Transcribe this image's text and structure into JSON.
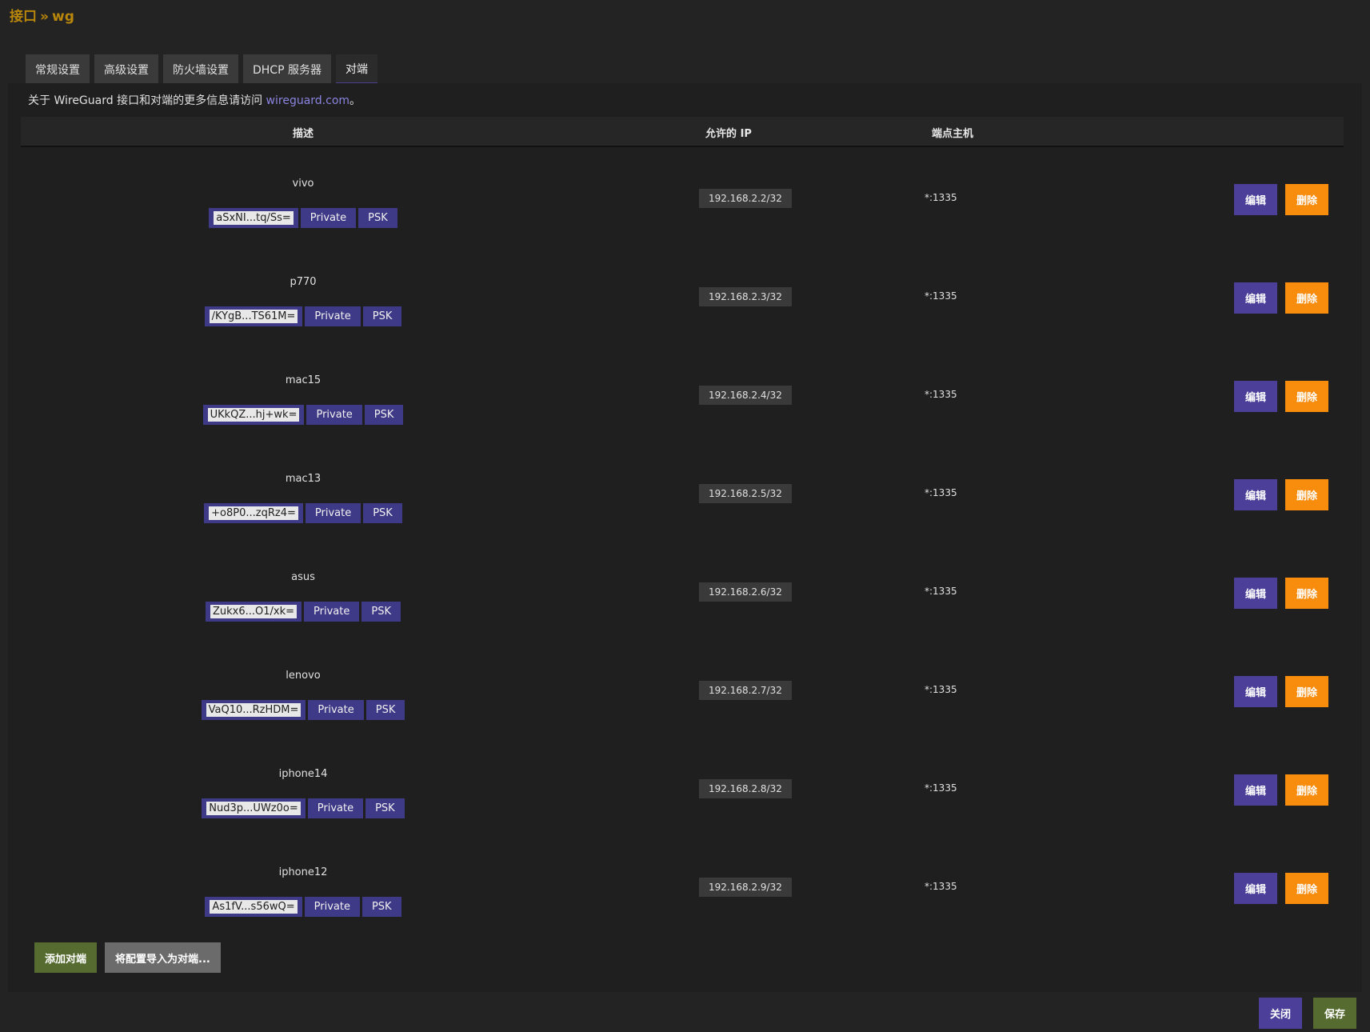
{
  "header": {
    "title_main": "接口",
    "title_sep": "»",
    "title_sub": "wg"
  },
  "tabs": [
    {
      "label": "常规设置"
    },
    {
      "label": "高级设置"
    },
    {
      "label": "防火墙设置"
    },
    {
      "label": "DHCP 服务器"
    },
    {
      "label": "对端"
    }
  ],
  "intro": {
    "text": "关于 WireGuard 接口和对端的更多信息请访问 ",
    "link": "wireguard.com",
    "suffix": "。"
  },
  "table": {
    "headers": {
      "desc": "描述",
      "allowed_ip": "允许的 IP",
      "endpoint": "端点主机"
    },
    "rows": [
      {
        "name": "vivo",
        "key": "aSxNI...tq/Ss=",
        "private": "Private",
        "psk": "PSK",
        "ip": "192.168.2.2/32",
        "endpoint": "*:1335",
        "edit": "编辑",
        "delete": "删除"
      },
      {
        "name": "p770",
        "key": "/KYgB...TS61M=",
        "private": "Private",
        "psk": "PSK",
        "ip": "192.168.2.3/32",
        "endpoint": "*:1335",
        "edit": "编辑",
        "delete": "删除"
      },
      {
        "name": "mac15",
        "key": "UKkQZ...hj+wk=",
        "private": "Private",
        "psk": "PSK",
        "ip": "192.168.2.4/32",
        "endpoint": "*:1335",
        "edit": "编辑",
        "delete": "删除"
      },
      {
        "name": "mac13",
        "key": "+o8P0...zqRz4=",
        "private": "Private",
        "psk": "PSK",
        "ip": "192.168.2.5/32",
        "endpoint": "*:1335",
        "edit": "编辑",
        "delete": "删除"
      },
      {
        "name": "asus",
        "key": "Zukx6...O1/xk=",
        "private": "Private",
        "psk": "PSK",
        "ip": "192.168.2.6/32",
        "endpoint": "*:1335",
        "edit": "编辑",
        "delete": "删除"
      },
      {
        "name": "lenovo",
        "key": "VaQ10...RzHDM=",
        "private": "Private",
        "psk": "PSK",
        "ip": "192.168.2.7/32",
        "endpoint": "*:1335",
        "edit": "编辑",
        "delete": "删除"
      },
      {
        "name": "iphone14",
        "key": "Nud3p...UWz0o=",
        "private": "Private",
        "psk": "PSK",
        "ip": "192.168.2.8/32",
        "endpoint": "*:1335",
        "edit": "编辑",
        "delete": "删除"
      },
      {
        "name": "iphone12",
        "key": "As1fV...s56wQ=",
        "private": "Private",
        "psk": "PSK",
        "ip": "192.168.2.9/32",
        "endpoint": "*:1335",
        "edit": "编辑",
        "delete": "删除"
      }
    ]
  },
  "actions": {
    "add_peer": "添加对端",
    "import_peer": "将配置导入为对端..."
  },
  "footer": {
    "close": "关闭",
    "save": "保存"
  },
  "colors": {
    "accent": "#4b3f9a",
    "danger": "#f78c0d",
    "success": "#556b2f",
    "title": "#b8860b"
  }
}
